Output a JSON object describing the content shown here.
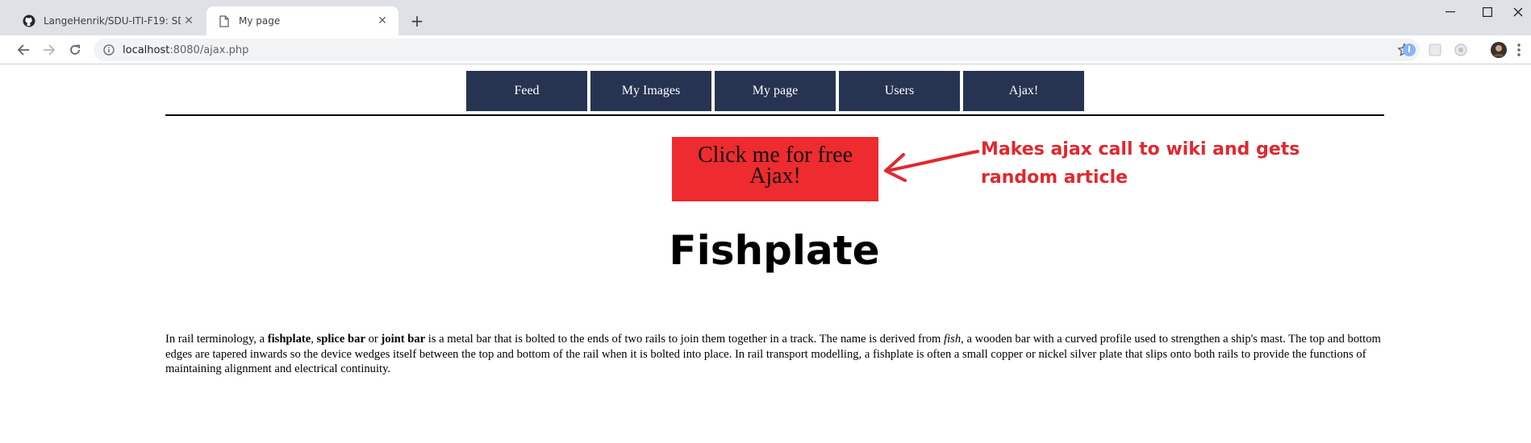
{
  "browser": {
    "tabs": [
      {
        "title": "LangeHenrik/SDU-ITI-F19: SDU I",
        "active": false,
        "icon": "github-icon"
      },
      {
        "title": "My page",
        "active": true,
        "icon": "page-icon"
      }
    ],
    "address": {
      "host": "localhost",
      "path": ":8080/ajax.php"
    }
  },
  "nav": {
    "items": [
      "Feed",
      "My Images",
      "My page",
      "Users",
      "Ajax!"
    ],
    "color": "#263351"
  },
  "ajax_button": {
    "label": "Click me for free Ajax!",
    "color": "#ee2b2e"
  },
  "annotation": {
    "text": "Makes ajax call to wiki and gets random article",
    "color": "#e0282f"
  },
  "article": {
    "title": "Fishplate",
    "body": {
      "t1": "In rail terminology, a ",
      "b1": "fishplate",
      "t2": ", ",
      "b2": "splice bar",
      "t3": " or ",
      "b3": "joint bar",
      "t4": " is a metal bar that is bolted to the ends of two rails to join them together in a track. The name is derived from ",
      "i1": "fish",
      "t5": ", a wooden bar with a curved profile used to strengthen a ship's mast. The top and bottom edges are tapered inwards so the device wedges itself between the top and bottom of the rail when it is bolted into place. In rail transport modelling, a fishplate is often a small copper or nickel silver plate that slips onto both rails to provide the functions of maintaining alignment and electrical continuity."
    }
  }
}
